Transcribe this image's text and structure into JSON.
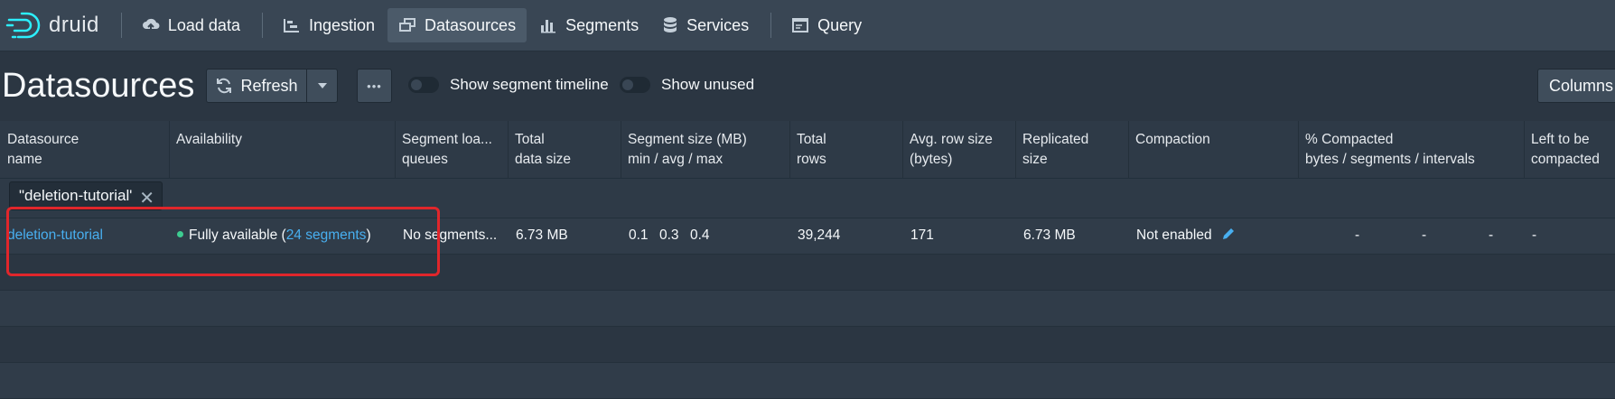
{
  "brand": {
    "name": "druid"
  },
  "nav": {
    "items": [
      {
        "label": "Load data",
        "icon": "cloud-upload-icon"
      },
      {
        "label": "Ingestion",
        "icon": "gantt-chart-icon"
      },
      {
        "label": "Datasources",
        "icon": "multi-select-icon",
        "active": true
      },
      {
        "label": "Segments",
        "icon": "stacked-chart-icon"
      },
      {
        "label": "Services",
        "icon": "database-icon"
      },
      {
        "label": "Query",
        "icon": "application-icon"
      }
    ]
  },
  "page": {
    "title": "Datasources",
    "refresh_label": "Refresh",
    "more_label": "•••",
    "toggle_timeline": "Show segment timeline",
    "toggle_unused": "Show unused",
    "columns_label": "Columns"
  },
  "table": {
    "headers": {
      "name": [
        "Datasource",
        "name"
      ],
      "availability": [
        "Availability",
        ""
      ],
      "load_queues": [
        "Segment loa...",
        "queues"
      ],
      "total_size": [
        "Total",
        "data size"
      ],
      "segment_size": [
        "Segment size (MB)",
        "min / avg / max"
      ],
      "total_rows": [
        "Total",
        "rows"
      ],
      "avg_row": [
        "Avg. row size",
        "(bytes)"
      ],
      "replicated": [
        "Replicated",
        "size"
      ],
      "compaction": [
        "Compaction",
        ""
      ],
      "compacted": [
        "% Compacted",
        "bytes / segments / intervals"
      ],
      "left": [
        "Left to be",
        "compacted"
      ]
    },
    "filter": {
      "value": "\"deletion-tutorial\"",
      "clear": "✕"
    },
    "rows": [
      {
        "name": "deletion-tutorial",
        "availability_prefix": "Fully available (",
        "availability_link": "24 segments",
        "availability_suffix": ")",
        "load_queues": "No segments...",
        "total_size": "6.73 MB",
        "seg_min": "0.1",
        "seg_avg": "0.3",
        "seg_max": "0.4",
        "total_rows": "39,244",
        "avg_row": "171",
        "replicated": "6.73 MB",
        "compaction": "Not enabled",
        "compacted_bytes": "-",
        "compacted_segments": "-",
        "compacted_intervals": "-",
        "left": "-"
      }
    ]
  },
  "colors": {
    "accent": "#48aff0",
    "available": "#3dcc91",
    "highlight": "#e0262b"
  }
}
